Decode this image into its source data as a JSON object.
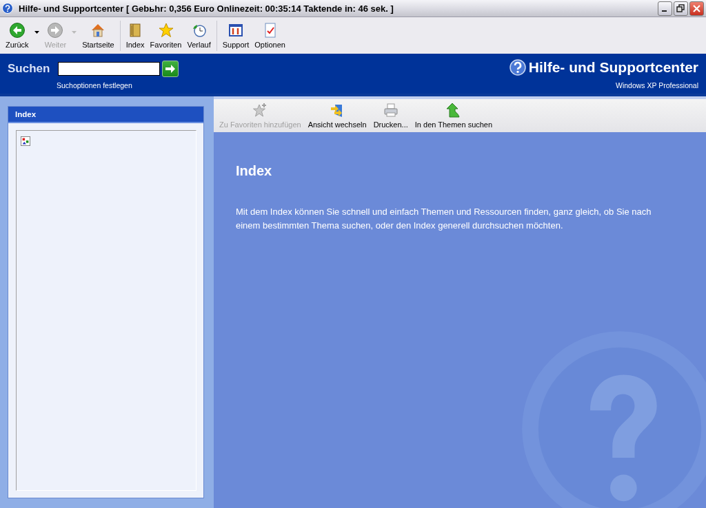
{
  "window": {
    "title": "Hilfe- und Supportcenter [ Gebьhr: 0,356 Euro Onlinezeit: 00:35:14 Taktende in: 46 sek. ]"
  },
  "toolbar": {
    "groups": [
      [
        {
          "label": "Zurück",
          "kind": "back",
          "disabled": false,
          "dropdown": true
        },
        {
          "label": "Weiter",
          "kind": "forward",
          "disabled": true,
          "dropdown": true
        },
        {
          "label": "Startseite",
          "kind": "home",
          "disabled": false,
          "dropdown": false
        }
      ],
      [
        {
          "label": "Index",
          "kind": "book",
          "disabled": false,
          "dropdown": false
        },
        {
          "label": "Favoriten",
          "kind": "star",
          "disabled": false,
          "dropdown": false
        },
        {
          "label": "Verlauf",
          "kind": "history",
          "disabled": false,
          "dropdown": false
        }
      ],
      [
        {
          "label": "Support",
          "kind": "support",
          "disabled": false,
          "dropdown": false
        },
        {
          "label": "Optionen",
          "kind": "options",
          "disabled": false,
          "dropdown": false
        }
      ]
    ]
  },
  "header": {
    "search_label": "Suchen",
    "search_options_link": "Suchoptionen festlegen",
    "product_title": "Hilfe- und Supportcenter",
    "edition": "Windows XP Professional"
  },
  "sidebar": {
    "title": "Index"
  },
  "content_toolbar": [
    {
      "label": "Zu Favoriten hinzufügen",
      "kind": "staradd",
      "disabled": true
    },
    {
      "label": "Ansicht wechseln",
      "kind": "switch",
      "disabled": false
    },
    {
      "label": "Drucken...",
      "kind": "printer",
      "disabled": false
    },
    {
      "label": "In den Themen suchen",
      "kind": "locate",
      "disabled": false
    }
  ],
  "content": {
    "heading": "Index",
    "text": "Mit dem Index können Sie schnell und einfach Themen und Ressourcen finden, ganz gleich, ob Sie nach einem bestimmten Thema suchen, oder den Index generell durchsuchen möchten."
  }
}
